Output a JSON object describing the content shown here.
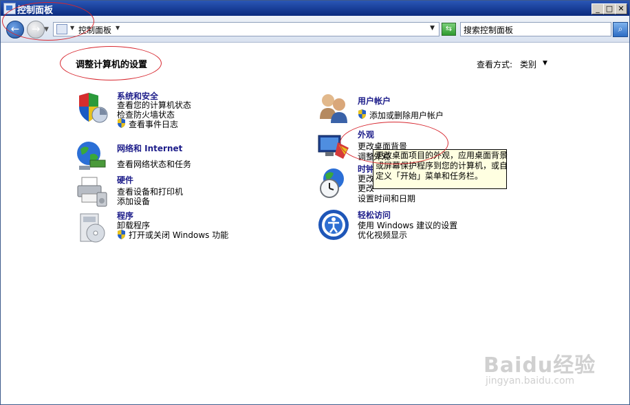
{
  "window": {
    "title": "控制面板"
  },
  "address": {
    "path": "控制面板",
    "search_placeholder": "搜索控制面板"
  },
  "header": {
    "heading": "调整计算机的设置",
    "view_label": "查看方式:",
    "view_value": "类别"
  },
  "categories": {
    "system": {
      "title": "系统和安全",
      "links": [
        "查看您的计算机状态",
        "检查防火墙状态",
        "查看事件日志"
      ]
    },
    "network": {
      "title": "网络和 Internet",
      "links": [
        "查看网络状态和任务"
      ]
    },
    "hardware": {
      "title": "硬件",
      "links": [
        "查看设备和打印机",
        "添加设备"
      ]
    },
    "programs": {
      "title": "程序",
      "links": [
        "卸载程序",
        "打开或关闭 Windows 功能"
      ]
    },
    "users": {
      "title": "用户帐户",
      "links": [
        "添加或删除用户帐户"
      ]
    },
    "appearance": {
      "title": "外观",
      "links": [
        "更改桌面背景",
        "调整",
        "外观"
      ]
    },
    "clock": {
      "title": "时钟",
      "links": [
        "更改",
        "更改",
        "设置时间和日期"
      ]
    },
    "ease": {
      "title": "轻松访问",
      "links": [
        "使用 Windows 建议的设置",
        "优化视频显示"
      ]
    }
  },
  "tooltip": {
    "lines": [
      "更改桌面项目的外观，应用桌面背景",
      "或屏幕保护程序到您的计算机，或自",
      "定义「开始」菜单和任务栏。"
    ]
  },
  "watermark": {
    "brand": "Baidu经验",
    "url": "jingyan.baidu.com"
  }
}
